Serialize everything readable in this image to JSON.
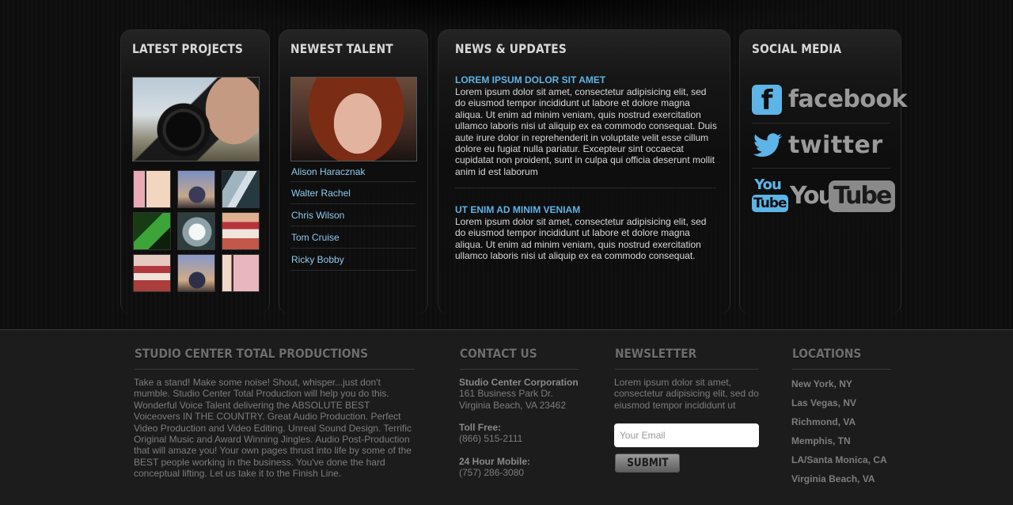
{
  "projects": {
    "title": "LATEST PROJECTS"
  },
  "talent": {
    "title": "NEWEST TALENT",
    "names": [
      "Alison Haracznak",
      "Walter Rachel",
      "Chris Wilson",
      "Tom Cruise",
      "Ricky Bobby"
    ]
  },
  "news": {
    "title": "NEWS & UPDATES",
    "items": [
      {
        "headline": "LOREM IPSUM DOLOR SIT AMET",
        "body": "Lorem ipsum dolor sit amet, consectetur adipisicing elit, sed do eiusmod tempor incididunt ut labore et dolore magna aliqua. Ut enim ad minim veniam, quis nostrud exercitation ullamco laboris nisi ut aliquip ex ea commodo consequat. Duis aute irure dolor in reprehenderit in voluptate velit esse cillum dolore eu fugiat nulla pariatur. Excepteur sint occaecat cupidatat non proident, sunt in culpa qui officia deserunt mollit anim id est laborum"
      },
      {
        "headline": "UT ENIM AD MINIM VENIAM",
        "body": "Lorem ipsum dolor sit amet, consectetur adipisicing elit, sed do eiusmod tempor incididunt ut labore et dolore magna aliqua. Ut enim ad minim veniam, quis nostrud exercitation ullamco laboris nisi ut aliquip ex ea commodo consequat."
      }
    ]
  },
  "social": {
    "title": "SOCIAL MEDIA",
    "facebook": {
      "icon": "facebook-icon",
      "glyph": "f",
      "label": "facebook"
    },
    "twitter": {
      "icon": "twitter-bird-icon",
      "label": "twitter"
    },
    "youtube": {
      "icon": "youtube-icon",
      "you": "You",
      "tube": "Tube"
    }
  },
  "footer": {
    "about": {
      "title": "STUDIO CENTER TOTAL PRODUCTIONS",
      "text": "Take a stand! Make some noise! Shout, whisper...just don't mumble. Studio Center Total Production will help you do this. Wonderful Voice Talent delivering the ABSOLUTE BEST Voiceovers IN THE COUNTRY. Great Audio Production. Perfect Video Production and Video Editing. Unreal Sound Design. Terrific Original Music and Award Winning Jingles. Audio Post-Production that will amaze you! Your own pages thrust into life by some of the BEST people working in the business. You've done the hard conceptual lifting. Let us take it to the Finish Line."
    },
    "contact": {
      "title": "CONTACT US",
      "company": "Studio Center Corporation",
      "address1": "161 Business Park Dr.",
      "address2": "Virginia Beach, VA 23462",
      "tollfree_label": "Toll Free:",
      "tollfree": "(866) 515-2111",
      "mobile_label": "24 Hour Mobile:",
      "mobile": "(757) 286-3080"
    },
    "newsletter": {
      "title": "NEWSLETTER",
      "text": "Lorem ipsum dolor sit amet, consectetur adipisicing elit, sed do eiusmod tempor incididunt ut",
      "email_placeholder": "Your Email",
      "submit_label": "SUBMIT"
    },
    "locations": {
      "title": "LOCATIONS",
      "items": [
        "New York, NY",
        "Las Vegas, NV",
        "Richmond, VA",
        "Memphis, TN",
        "LA/Santa Monica, CA",
        "Virginia Beach, VA"
      ]
    }
  },
  "colors": {
    "accent_blue": "#5db4e6",
    "link_blue": "#8ecbef",
    "background": "#0c0c0c",
    "footer_bg": "#1c1c1c"
  }
}
